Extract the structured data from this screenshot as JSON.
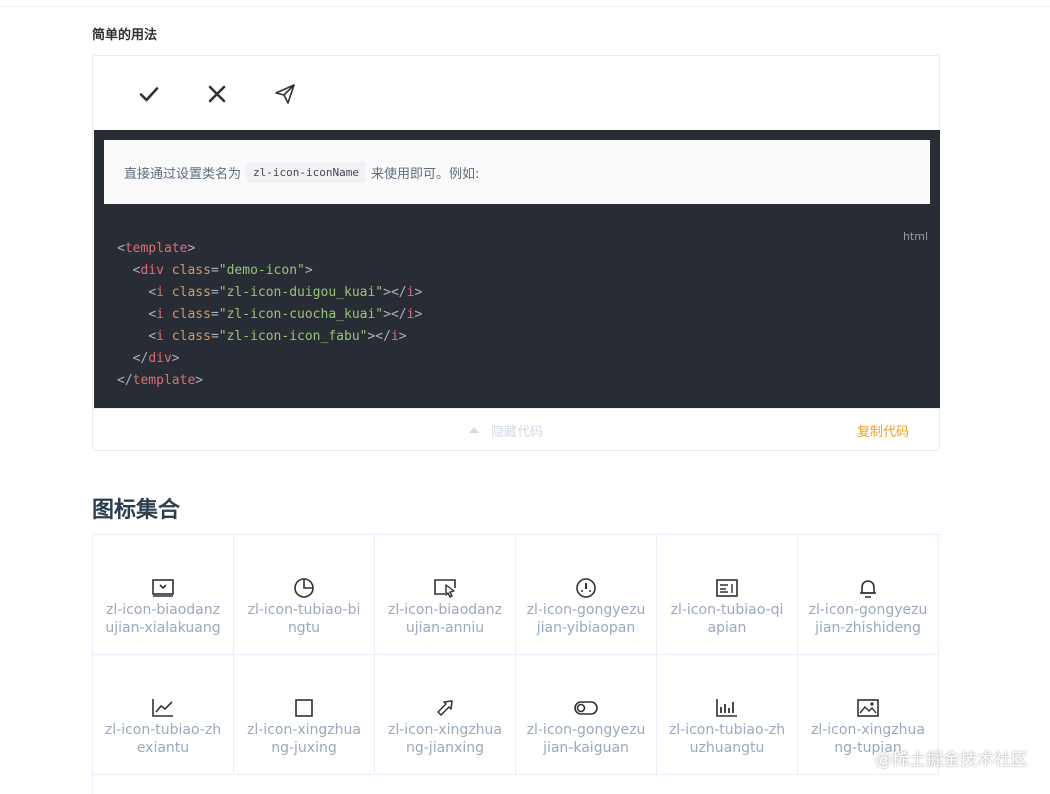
{
  "section_title": "简单的用法",
  "demo": {
    "icons": [
      "check-icon",
      "close-icon",
      "send-icon"
    ],
    "description_before": "直接通过设置类名为",
    "description_code": "zl-icon-iconName",
    "description_after": "来使用即可。例如:",
    "lang_label": "html",
    "code": {
      "line1_open": "<",
      "line1_tag": "template",
      "line1_close": ">",
      "line2_tag": "div",
      "line2_attr": "class",
      "line2_value": "\"demo-icon\"",
      "line3_value": "\"zl-icon-duigou_kuai\"",
      "line4_value": "\"zl-icon-cuocha_kuai\"",
      "line5_value": "\"zl-icon-icon_fabu\"",
      "i_tag": "i"
    },
    "hide_code_label": "隐藏代码",
    "copy_code_label": "复制代码"
  },
  "collection_title": "图标集合",
  "icon_collection": [
    {
      "icon": "form-dropdown-icon",
      "label": "zl-icon-biaodanzujian-xialakuang"
    },
    {
      "icon": "pie-chart-icon",
      "label": "zl-icon-tubiao-bingtu"
    },
    {
      "icon": "form-button-icon",
      "label": "zl-icon-biaodanzujian-anniu"
    },
    {
      "icon": "gauge-icon",
      "label": "zl-icon-gongyezujian-yibiaopan"
    },
    {
      "icon": "card-icon",
      "label": "zl-icon-tubiao-qiapian"
    },
    {
      "icon": "bell-light-icon",
      "label": "zl-icon-gongyezujian-zhishideng"
    },
    {
      "icon": "line-chart-icon",
      "label": "zl-icon-tubiao-zhexiantu"
    },
    {
      "icon": "rectangle-icon",
      "label": "zl-icon-xingzhuang-juxing"
    },
    {
      "icon": "arrow-shape-icon",
      "label": "zl-icon-xingzhuang-jianxing"
    },
    {
      "icon": "toggle-switch-icon",
      "label": "zl-icon-gongyezujian-kaiguan"
    },
    {
      "icon": "bar-chart-icon",
      "label": "zl-icon-tubiao-zhuzhuangtu"
    },
    {
      "icon": "image-icon",
      "label": "zl-icon-xingzhuang-tupian"
    }
  ],
  "watermark": "@稀土掘金技术社区"
}
